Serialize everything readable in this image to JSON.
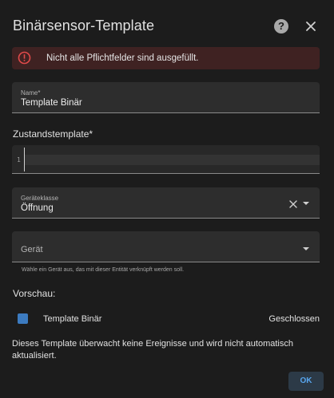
{
  "dialog": {
    "title": "Binärsensor-Template",
    "help_icon": "help-circle-icon",
    "close_icon": "close-icon"
  },
  "alert": {
    "icon": "alert-circle-icon",
    "color": "#e04a4a",
    "message": "Nicht alle Pflichtfelder sind ausgefüllt."
  },
  "name_field": {
    "label": "Name*",
    "value": "Template Binär"
  },
  "state_template": {
    "label": "Zustandstemplate*",
    "line_number": "1",
    "value": ""
  },
  "device_class": {
    "label": "Geräteklasse",
    "value": "Öffnung",
    "clear_icon": "close-icon",
    "dropdown_icon": "menu-down-icon"
  },
  "device": {
    "placeholder": "Gerät",
    "helper": "Wähle ein Gerät aus, das mit dieser Entität verknüpft werden soll.",
    "dropdown_icon": "menu-down-icon"
  },
  "preview": {
    "label": "Vorschau:",
    "icon": "square-icon",
    "entity_name": "Template Binär",
    "state": "Geschlossen",
    "info": "Dieses Template überwacht keine Ereignisse und wird nicht automatisch aktualisiert."
  },
  "actions": {
    "ok_label": "OK",
    "accent": "#58a6ee"
  }
}
